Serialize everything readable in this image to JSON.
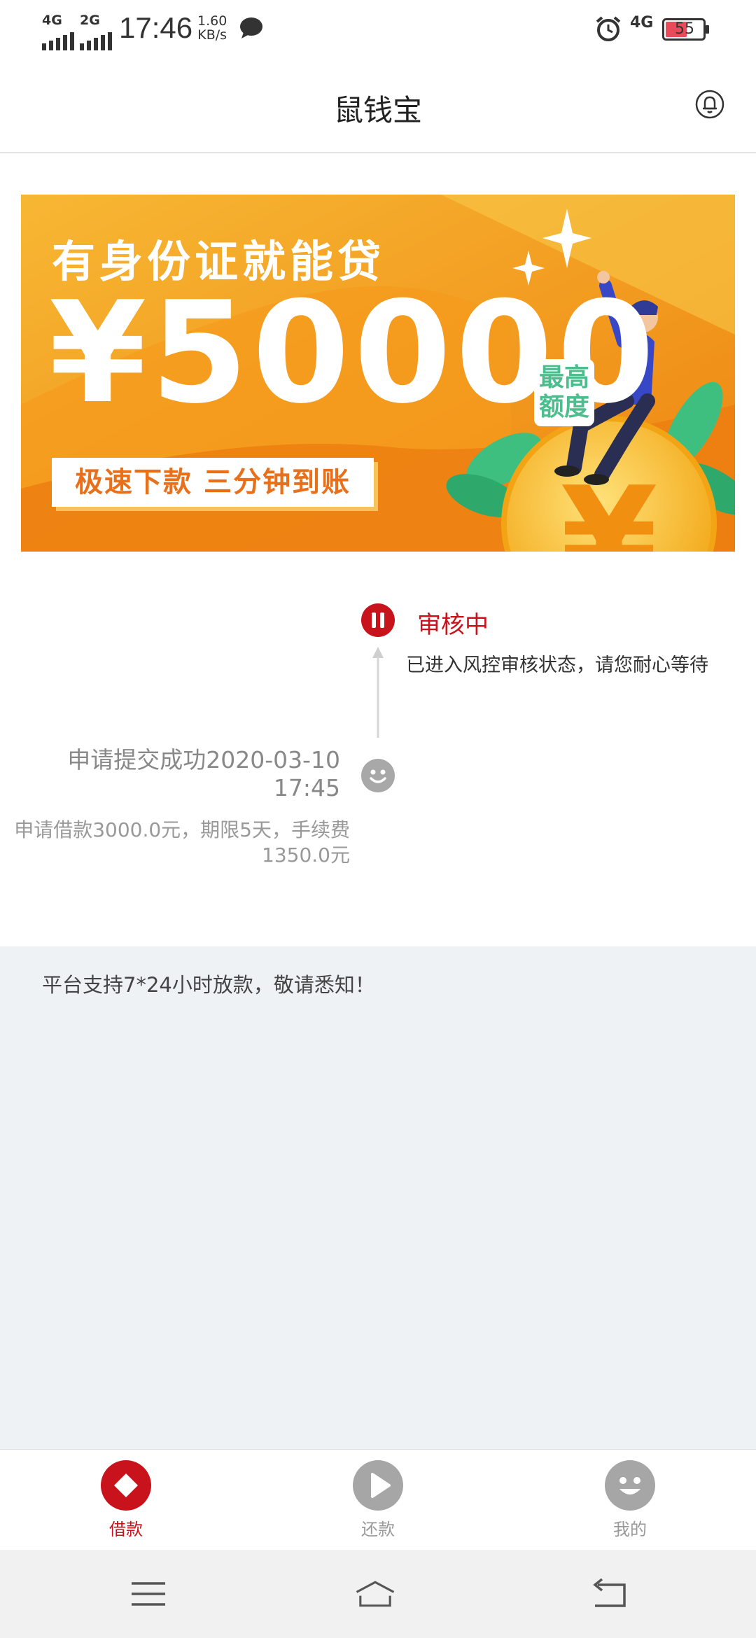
{
  "status_bar": {
    "network_1": "4G",
    "network_2": "2G",
    "time": "17:46",
    "speed_value": "1.60",
    "speed_unit": "KB/s",
    "network_3": "4G",
    "battery": "55",
    "icons": [
      "signal-icon",
      "message-icon",
      "alarm-icon",
      "battery-icon"
    ]
  },
  "header": {
    "title": "鼠钱宝",
    "right_icon": "bell-icon"
  },
  "banner": {
    "line1": "有身份证就能贷",
    "amount": "¥50000",
    "max_label": "最高额度",
    "tagline": "极速下款  三分钟到账",
    "colors": {
      "bg_start": "#f5a623",
      "bg_end": "#ef8a10",
      "coin": "#f7c531"
    }
  },
  "timeline": {
    "current": {
      "title": "审核中",
      "description": "已进入风控审核状态，请您耐心等待",
      "icon": "pause-icon",
      "color": "#c8131c"
    },
    "submitted": {
      "title": "申请提交成功2020-03-10 17:45",
      "description": "申请借款3000.0元，期限5天，手续费1350.0元",
      "icon": "smile-icon"
    }
  },
  "notice": {
    "text": "平台支持7*24小时放款，敬请悉知！"
  },
  "tabs": [
    {
      "label": "借款",
      "icon": "diamond-icon",
      "active": true
    },
    {
      "label": "还款",
      "icon": "play-icon",
      "active": false
    },
    {
      "label": "我的",
      "icon": "smile-icon",
      "active": false
    }
  ],
  "nav": {
    "icons": [
      "menu-icon",
      "home-icon",
      "back-icon"
    ]
  }
}
